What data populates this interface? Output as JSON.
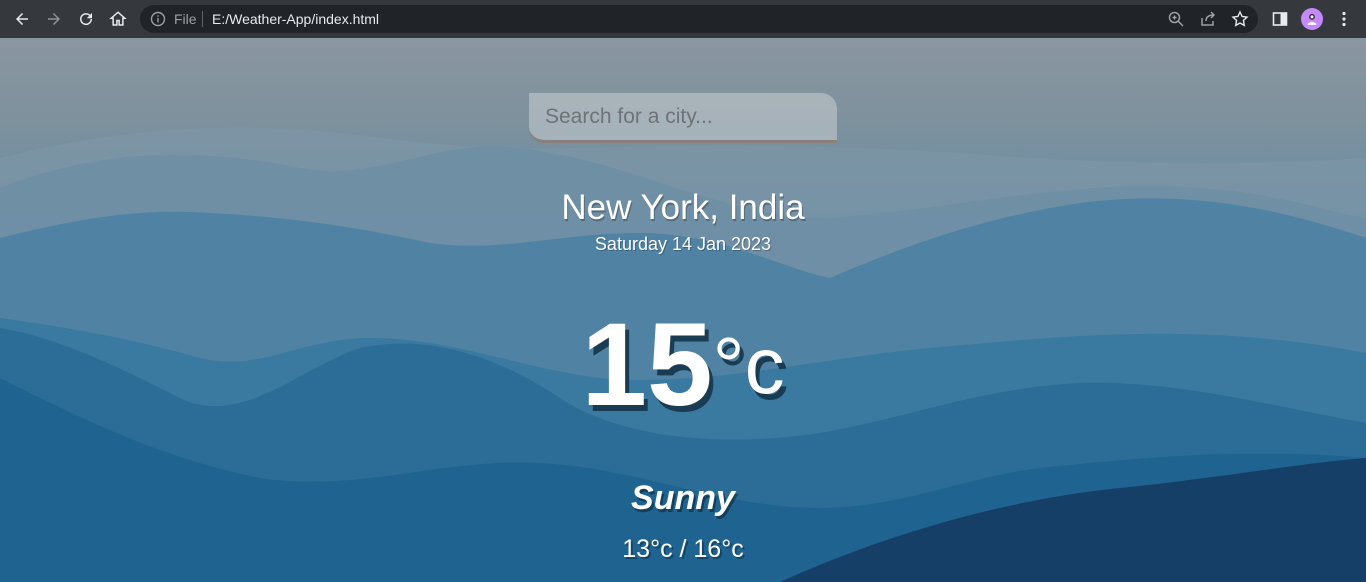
{
  "browser": {
    "file_label": "File",
    "url": "E:/Weather-App/index.html",
    "icons": [
      "back-icon",
      "forward-icon",
      "reload-icon",
      "home-icon",
      "info-icon",
      "zoom-icon",
      "share-icon",
      "star-icon",
      "sidebar-icon",
      "profile-avatar",
      "menu-icon"
    ]
  },
  "weather": {
    "search_placeholder": "Search for a city...",
    "location": "New York, India",
    "date": "Saturday 14 Jan 2023",
    "temp_value": "15",
    "temp_unit": "°c",
    "condition": "Sunny",
    "range": "13°c / 16°c"
  },
  "colors": {
    "toolbar_bg": "#35393d",
    "omnibox_bg": "#202327",
    "avatar_bg": "#c58af9",
    "sky_top": "#8a96a0",
    "mountains_dark": "#1c5a85"
  }
}
